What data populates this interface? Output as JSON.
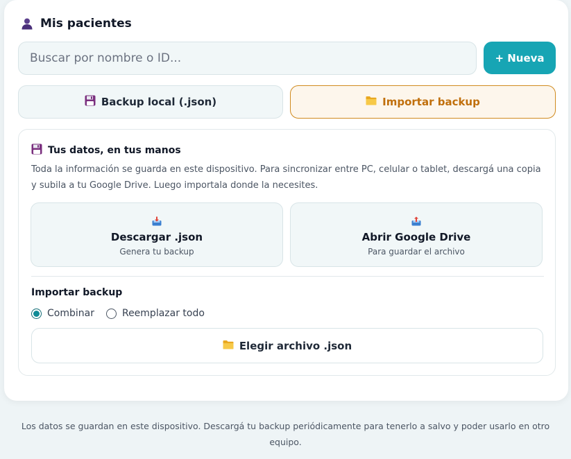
{
  "header": {
    "title": "Mis pacientes",
    "icon": "person-icon"
  },
  "search": {
    "placeholder": "Buscar por nombre o ID...",
    "value": ""
  },
  "buttons": {
    "new_label": "+ Nueva",
    "backup_local_label": "Backup local (.json)",
    "import_backup_label": "Importar backup"
  },
  "panel": {
    "title": "Tus datos, en tus manos",
    "description": "Toda la información se guarda en este dispositivo. Para sincronizar entre PC, celular o tablet, descargá una copia y subila a tu Google Drive. Luego importala donde la necesites.",
    "download": {
      "label": "Descargar .json",
      "sub": "Genera tu backup"
    },
    "drive": {
      "label": "Abrir Google Drive",
      "sub": "Para guardar el archivo"
    },
    "import_title": "Importar backup",
    "options": [
      {
        "label": "Combinar",
        "checked": true
      },
      {
        "label": "Reemplazar todo",
        "checked": false
      }
    ],
    "choose_file_label": "Elegir archivo .json"
  },
  "footer": {
    "text": "Los datos se guardan en este dispositivo. Descargá tu backup periódicamente para tenerlo a salvo y poder usarlo en otro equipo."
  },
  "colors": {
    "accent": "#17a5b4",
    "import_accent": "#c06f0c",
    "background": "#eef4f6"
  }
}
